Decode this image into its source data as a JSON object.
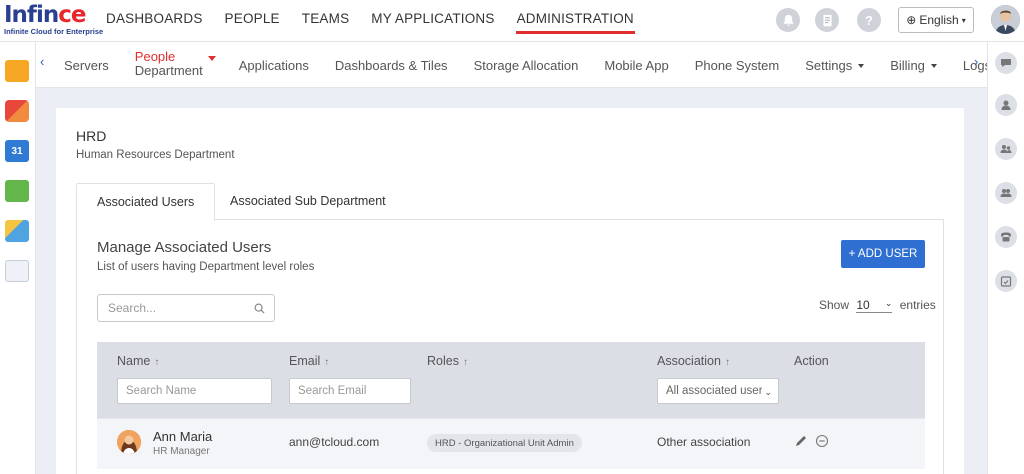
{
  "brand": {
    "name_main": "Infin",
    "name_accent": "ce",
    "tagline": "Infinite Cloud for Enterprise"
  },
  "top_nav": [
    {
      "label": "DASHBOARDS",
      "active": false
    },
    {
      "label": "PEOPLE",
      "active": false
    },
    {
      "label": "TEAMS",
      "active": false
    },
    {
      "label": "MY APPLICATIONS",
      "active": false
    },
    {
      "label": "ADMINISTRATION",
      "active": true
    }
  ],
  "top_icons": [
    "bell-icon",
    "task-icon",
    "help-icon"
  ],
  "language": {
    "label": "English",
    "icon": "globe-icon"
  },
  "sub_nav": {
    "items": [
      {
        "label": "Servers"
      },
      {
        "label_top": "People",
        "label_bottom": "Department",
        "active": true
      },
      {
        "label": "Applications"
      },
      {
        "label": "Dashboards & Tiles"
      },
      {
        "label": "Storage Allocation"
      },
      {
        "label": "Mobile App"
      },
      {
        "label": "Phone System"
      },
      {
        "label": "Settings",
        "dropdown": true
      },
      {
        "label": "Billing",
        "dropdown": true
      },
      {
        "label": "Logs"
      }
    ],
    "help_icon_text": "?",
    "calendar_day": "31"
  },
  "department": {
    "name": "HRD",
    "description": "Human Resources Department"
  },
  "tabs": [
    {
      "label": "Associated Users",
      "active": true
    },
    {
      "label": "Associated Sub Department",
      "active": false
    }
  ],
  "section": {
    "title": "Manage Associated Users",
    "subtitle": "List of users having Department level roles",
    "add_button": "+ ADD USER",
    "search_placeholder": "Search...",
    "show_label": "Show",
    "entries_value": "10",
    "entries_label": "entries"
  },
  "table": {
    "columns": [
      {
        "label": "Name",
        "sort": "↑"
      },
      {
        "label": "Email",
        "sort": "↑"
      },
      {
        "label": "Roles",
        "sort": "↑"
      },
      {
        "label": "Association",
        "sort": "↑"
      },
      {
        "label": "Action"
      }
    ],
    "filters": {
      "name_placeholder": "Search Name",
      "email_placeholder": "Search Email",
      "association_value": "All associated users"
    },
    "rows": [
      {
        "name": "Ann Maria",
        "title": "HR Manager",
        "email": "ann@tcloud.com",
        "role": "HRD - Organizational Unit Admin",
        "association": "Other association"
      }
    ]
  },
  "colors": {
    "accent_red": "#e02d2d",
    "primary_blue": "#2f6fd1",
    "brand_navy": "#2a3f8f"
  }
}
